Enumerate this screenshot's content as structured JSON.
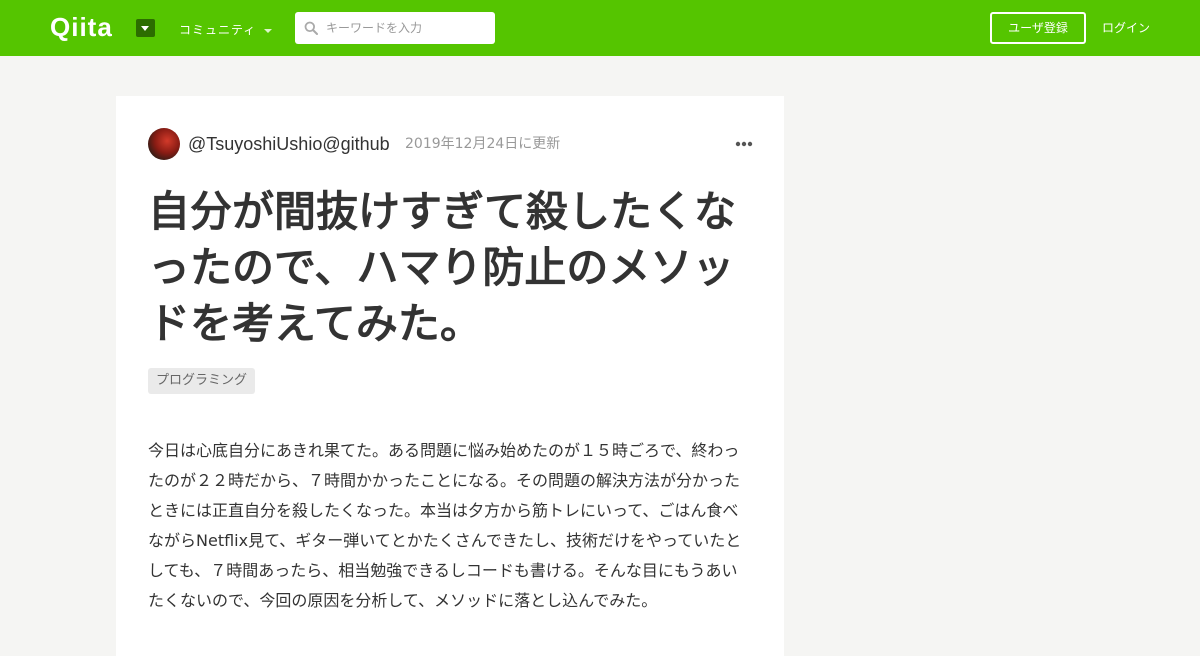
{
  "header": {
    "logo": "Qiita",
    "community_label": "コミュニティ",
    "search_placeholder": "キーワードを入力",
    "signup_label": "ユーザ登録",
    "login_label": "ログイン",
    "brand_color": "#55c500"
  },
  "article": {
    "author": "@TsuyoshiUshio@github",
    "updated_at": "2019年12月24日に更新",
    "title": "自分が間抜けすぎて殺したくなったので、ハマり防止のメソッドを考えてみた。",
    "tags": [
      "プログラミング"
    ],
    "body": "今日は心底自分にあきれ果てた。ある問題に悩み始めたのが１５時ごろで、終わったのが２２時だから、７時間かかったことになる。その問題の解決方法が分かったときには正直自分を殺したくなった。本当は夕方から筋トレにいって、ごはん食べながらNetflix見て、ギター弾いてとかたくさんできたし、技術だけをやっていたとしても、７時間あったら、相当勉強できるしコードも書ける。そんな目にもうあいたくないので、今回の原因を分析して、メソッドに落とし込んでみた。"
  }
}
